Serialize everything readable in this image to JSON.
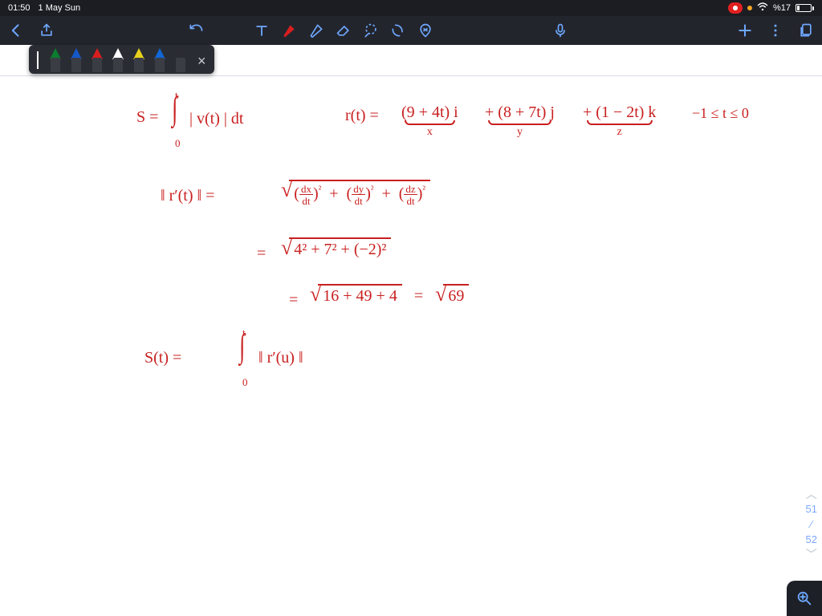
{
  "status": {
    "time": "01:50",
    "date": "1 May Sun",
    "battery_pct": "%17",
    "wifi_icon": "wifi"
  },
  "toolbar": {
    "back": "‹",
    "share": "share",
    "undo": "undo",
    "text_tool": "T",
    "pen": "pen",
    "eraser1": "eraser",
    "eraser2": "shape-eraser",
    "lasso": "lasso",
    "cut": "scissors",
    "mic": "mic",
    "add": "+",
    "more": "⋮",
    "pages": "pages",
    "dots": "• • •"
  },
  "pens": [
    {
      "color": "#0b7d2f"
    },
    {
      "color": "#1558c9"
    },
    {
      "color": "#d81e1e"
    },
    {
      "color": "#ffffff"
    },
    {
      "color": "#e8d21c"
    },
    {
      "color": "#1167d6"
    },
    {
      "color": "#2a2c33"
    }
  ],
  "page_nav": {
    "current": "51",
    "total": "52"
  },
  "handwriting": {
    "line1_s": "S =",
    "line1_int_top": "t",
    "line1_int_bot": "0",
    "line1_integrand": "| v(t) |  dt",
    "line1_r": "r(t) =",
    "line1_x": "(9 + 4t) i",
    "line1_x_lbl": "x",
    "line1_y": "+  (8 + 7t) j",
    "line1_y_lbl": "y",
    "line1_z": "+ (1 − 2t) k",
    "line1_z_lbl": "z",
    "line1_dom": "−1 ≤ t ≤ 0",
    "line2_lhs": "‖ r′(t) ‖   =",
    "line2_dx": "dx",
    "line2_dy": "dy",
    "line2_dz": "dz",
    "line2_dt": "dt",
    "line2_sq": "²",
    "line3_eq": "=",
    "line3_body": "4²  +  7²  +  (−2)²",
    "line4_eq": "=",
    "line4_body": "16 + 49 + 4",
    "line4_res": "69",
    "line5_lhs": "S(t)   =",
    "line5_int_top": "t",
    "line5_int_bot": "0",
    "line5_integrand": "‖ r′(u) ‖"
  }
}
